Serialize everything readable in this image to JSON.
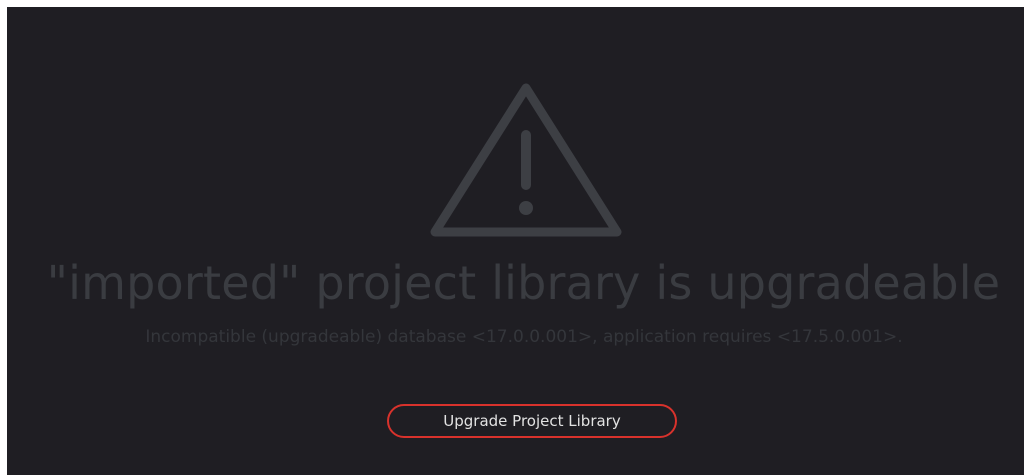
{
  "dialog": {
    "icon": "warning-triangle-icon",
    "title": "\"imported\" project library is upgradeable",
    "message": "Incompatible (upgradeable) database <17.0.0.001>, application requires <17.5.0.001>.",
    "button_label": "Upgrade Project Library"
  },
  "colors": {
    "background": "#1f1e23",
    "icon": "#3d3f44",
    "title_text": "#3a3c41",
    "message_text": "#34363b",
    "button_border": "#d8322c",
    "button_text": "#e2e2e2"
  }
}
